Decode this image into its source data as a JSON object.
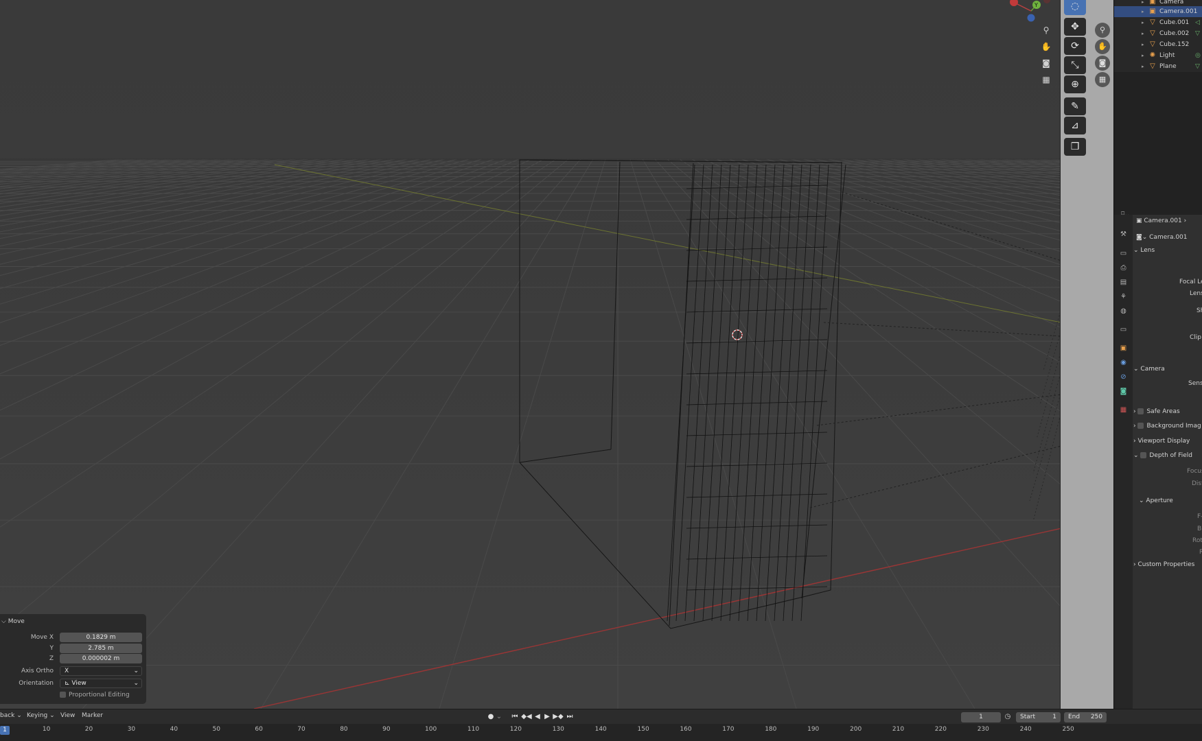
{
  "outliner": {
    "items": [
      {
        "label": "Camera",
        "icon": "camera-object-icon",
        "selected": false
      },
      {
        "label": "Camera.001",
        "icon": "camera-object-icon",
        "selected": true
      },
      {
        "label": "Cube.001",
        "icon": "mesh-object-icon",
        "selected": false
      },
      {
        "label": "Cube.002",
        "icon": "mesh-object-icon",
        "selected": false
      },
      {
        "label": "Cube.152",
        "icon": "mesh-object-icon",
        "selected": false
      },
      {
        "label": "Light",
        "icon": "light-object-icon",
        "selected": false
      },
      {
        "label": "Plane",
        "icon": "mesh-object-icon",
        "selected": false
      }
    ]
  },
  "gizmo": {
    "y_label": "Y",
    "x_label": "X"
  },
  "properties": {
    "object_name": "Camera.001",
    "data_name": "Camera.001",
    "sections": {
      "lens": "Lens",
      "focal_length": "Focal Le",
      "lens_unit": "Lens",
      "shift": "Sh",
      "clip": "Clip",
      "camera": "Camera",
      "sensor": "Senso",
      "safe_areas": "Safe Areas",
      "background_images": "Background Imag",
      "viewport_display": "Viewport Display",
      "depth_of_field": "Depth of Field",
      "focus_object": "Focus O",
      "distance": "Dista",
      "aperture": "Aperture",
      "fstop": "F-",
      "blades": "Bl",
      "rotation": "Rota",
      "ratio": "R",
      "custom_properties": "Custom Properties"
    }
  },
  "operator": {
    "title": "Move",
    "move_x_label": "Move X",
    "move_x": "0.1829 m",
    "y_label": "Y",
    "y": "2.785 m",
    "z_label": "Z",
    "z": "0.000002 m",
    "axis_ortho_label": "Axis Ortho",
    "axis_ortho": "X",
    "orientation_label": "Orientation",
    "orientation": "View",
    "proportional": "Proportional Editing"
  },
  "timeline": {
    "menus": [
      "back",
      "Keying",
      "View",
      "Marker"
    ],
    "current_frame": "1",
    "start_label": "Start",
    "start": "1",
    "end_label": "End",
    "end": "250",
    "ruler_current": "1",
    "ticks": [
      "10",
      "20",
      "30",
      "40",
      "50",
      "60",
      "70",
      "80",
      "90",
      "100",
      "110",
      "120",
      "130",
      "140",
      "150",
      "160",
      "170",
      "180",
      "190",
      "200",
      "210",
      "220",
      "230",
      "240",
      "250"
    ]
  },
  "colors": {
    "selected": "#334d80",
    "accent": "#4772b3",
    "x_axis": "#c23a3a",
    "y_axis": "#7d8a2d"
  }
}
